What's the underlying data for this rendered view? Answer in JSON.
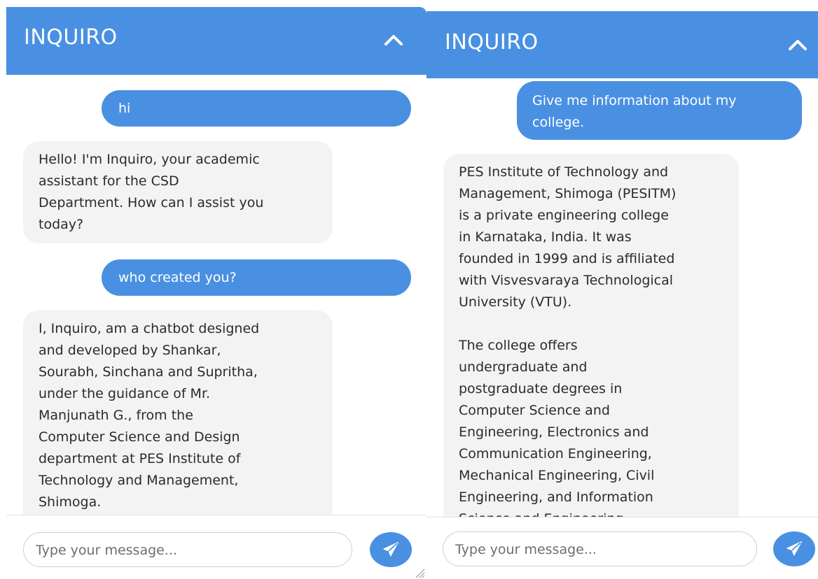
{
  "colors": {
    "header_bg": "#4a90e2",
    "user_bubble": "#4a90e2",
    "bot_bubble": "#f3f3f4"
  },
  "icons": {
    "collapse": "chevron-up-icon",
    "send": "paper-plane-icon",
    "resize": "resize-grip-icon"
  },
  "panels": [
    {
      "header": {
        "title": "INQUIRO"
      },
      "messages": [
        {
          "role": "user",
          "text": "hi"
        },
        {
          "role": "bot",
          "text": "Hello! I'm Inquiro, your academic\nassistant for the CSD\nDepartment. How can I assist you\ntoday?"
        },
        {
          "role": "user",
          "text": "who created you?"
        },
        {
          "role": "bot",
          "text": "I, Inquiro, am a chatbot designed\nand developed by Shankar,\nSourabh, Sinchana and Supritha,\nunder the guidance of Mr.\nManjunath G., from the\nComputer Science and Design\ndepartment at PES Institute of\nTechnology and Management,\nShimoga."
        }
      ],
      "input": {
        "placeholder": "Type your message..."
      }
    },
    {
      "header": {
        "title": "INQUIRO"
      },
      "messages": [
        {
          "role": "user",
          "text": "Give me information about my\ncollege."
        },
        {
          "role": "bot",
          "text": "PES Institute of Technology and\nManagement, Shimoga (PESITM)\nis a private engineering college\nin Karnataka, India. It was\nfounded in 1999 and is affiliated\nwith Visvesvaraya Technological\nUniversity (VTU).\n\nThe college offers\nundergraduate and\npostgraduate degrees in\nComputer Science and\nEngineering, Electronics and\nCommunication Engineering,\nMechanical Engineering, Civil\nEngineering, and Information\nScience and Engineering."
        }
      ],
      "input": {
        "placeholder": "Type your message..."
      }
    }
  ]
}
